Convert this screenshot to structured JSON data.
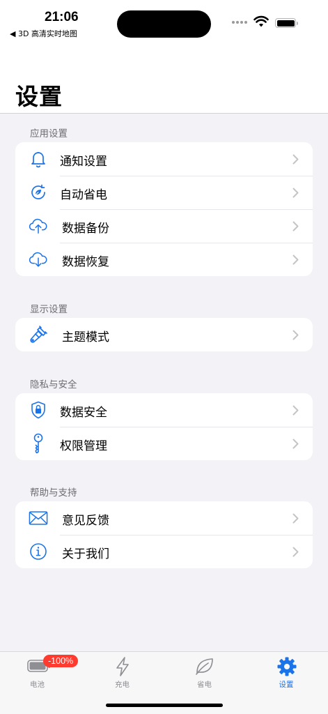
{
  "status_bar": {
    "time": "21:06",
    "back_app": "◀ 3D 高清实时地图"
  },
  "page": {
    "title": "设置"
  },
  "sections": [
    {
      "header": "应用设置",
      "items": [
        {
          "label": "通知设置",
          "icon": "bell-icon"
        },
        {
          "label": "自动省电",
          "icon": "auto-save-power-icon"
        },
        {
          "label": "数据备份",
          "icon": "cloud-upload-icon"
        },
        {
          "label": "数据恢复",
          "icon": "cloud-download-icon"
        }
      ]
    },
    {
      "header": "显示设置",
      "items": [
        {
          "label": "主题模式",
          "icon": "paintbrush-icon"
        }
      ]
    },
    {
      "header": "隐私与安全",
      "items": [
        {
          "label": "数据安全",
          "icon": "lock-shield-icon"
        },
        {
          "label": "权限管理",
          "icon": "key-icon"
        }
      ]
    },
    {
      "header": "帮助与支持",
      "items": [
        {
          "label": "意见反馈",
          "icon": "envelope-icon"
        },
        {
          "label": "关于我们",
          "icon": "info-icon"
        }
      ]
    }
  ],
  "tab_bar": {
    "tabs": [
      {
        "label": "电池",
        "icon": "battery-icon",
        "badge": "-100%"
      },
      {
        "label": "充电",
        "icon": "bolt-icon"
      },
      {
        "label": "省电",
        "icon": "leaf-icon"
      },
      {
        "label": "设置",
        "icon": "gear-icon",
        "active": true
      }
    ]
  },
  "colors": {
    "accent": "#1a73e8",
    "background": "#f2f2f7",
    "badge": "#ff3b30"
  }
}
